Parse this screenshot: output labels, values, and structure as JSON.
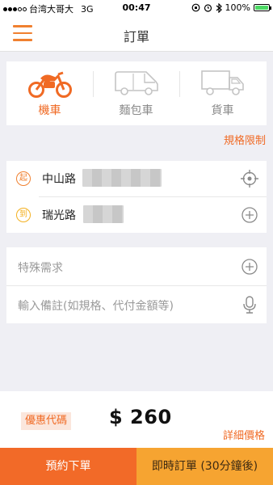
{
  "status_bar": {
    "carrier": "台湾大哥大",
    "network": "3G",
    "time": "00:47",
    "battery": "100%"
  },
  "header": {
    "title": "訂單",
    "menu_icon": "hamburger-menu-icon"
  },
  "vehicles": {
    "selected": "scooter",
    "items": [
      {
        "label": "機車",
        "icon": "scooter-icon"
      },
      {
        "label": "麵包車",
        "icon": "van-icon"
      },
      {
        "label": "貨車",
        "icon": "truck-icon"
      }
    ]
  },
  "spec_link": "規格限制",
  "route": {
    "pickup": {
      "badge": "起",
      "address": "中山路",
      "action_icon": "locate-target-icon"
    },
    "dropoff": {
      "badge": "到",
      "address": "瑞光路",
      "action_icon": "add-circle-icon"
    }
  },
  "extras": {
    "special_request": "特殊需求",
    "note_placeholder": "輸入備註(如規格、代付金額等)",
    "mic_icon": "microphone-icon"
  },
  "pricing": {
    "coupon_label": "優惠代碼",
    "price": "$ 260",
    "detail_link": "詳細價格"
  },
  "actions": {
    "reserve": "預約下單",
    "instant": "即時訂單 (30分鐘後)"
  },
  "colors": {
    "accent": "#f06a24",
    "instant_button": "#f6a431",
    "reserve_button": "#f26a28"
  }
}
